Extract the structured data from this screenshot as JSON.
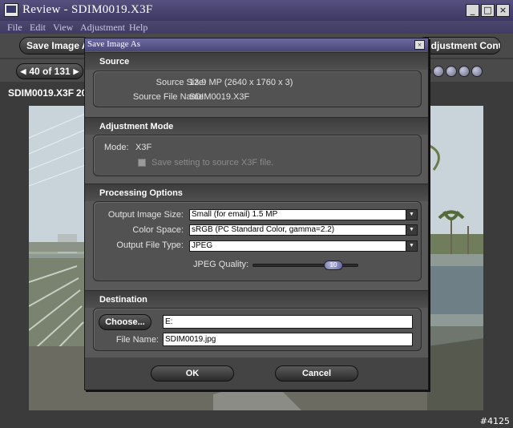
{
  "window": {
    "title": "Review - SDIM0019.X3F",
    "controls": {
      "minimize": "_",
      "maximize": "□",
      "close": "×"
    }
  },
  "menu": [
    "File",
    "Edit",
    "View",
    "Adjustment",
    "Help"
  ],
  "toolbar": {
    "save_image_label": "Save Image A",
    "adjustment_controls_label": "Adjustment Controls"
  },
  "nav": {
    "counter": "40 of 131"
  },
  "filebar": {
    "filename": "SDIM0019.X3F",
    "extra": "20"
  },
  "footer": {
    "id": "#4125"
  },
  "dialog": {
    "title": "Save Image As",
    "close": "×",
    "source": {
      "header": "Source",
      "size_label": "Source Size:",
      "size_value": "13.9 MP (2640 x 1760 x 3)",
      "filename_label": "Source File Name:",
      "filename_value": "SDIM0019.X3F"
    },
    "adjustment": {
      "header": "Adjustment Mode",
      "mode_label": "Mode:",
      "mode_value": "X3F",
      "save_setting_label": "Save setting to source X3F file."
    },
    "processing": {
      "header": "Processing Options",
      "output_size_label": "Output Image Size:",
      "output_size_value": "Small (for email) 1.5 MP",
      "color_space_label": "Color Space:",
      "color_space_value": "sRGB (PC Standard Color, gamma=2.2)",
      "file_type_label": "Output File Type:",
      "file_type_value": "JPEG",
      "jpeg_quality_label": "JPEG Quality:",
      "jpeg_quality_value": "10"
    },
    "destination": {
      "header": "Destination",
      "choose_label": "Choose...",
      "path_value": "E:",
      "filename_label": "File Name:",
      "filename_value": "SDIM0019.jpg"
    },
    "ok_label": "OK",
    "cancel_label": "Cancel"
  }
}
